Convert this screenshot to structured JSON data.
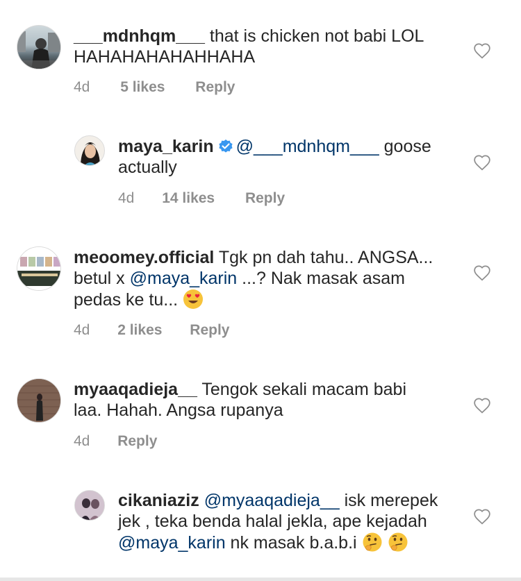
{
  "comments": [
    {
      "username": "___mdnhqm___",
      "text": " that is chicken not babi LOL HAHAHAHAHAHHAHA",
      "time": "4d",
      "likes": "5 likes",
      "reply": "Reply"
    },
    {
      "username": "maya_karin",
      "mention": "@___mdnhqm___",
      "text": " goose actually",
      "time": "4d",
      "likes": "14 likes",
      "reply": "Reply"
    },
    {
      "username": "meoomey.official",
      "text_a": " Tgk pn dah tahu.. ANGSA... betul x ",
      "mention": "@maya_karin",
      "text_b": " ...? Nak masak asam pedas ke tu... ",
      "time": "4d",
      "likes": "2 likes",
      "reply": "Reply"
    },
    {
      "username": "myaaqadieja__",
      "text": " Tengok sekali macam babi laa. Hahah. Angsa rupanya",
      "time": "4d",
      "reply": "Reply"
    },
    {
      "username": "cikaniaziz",
      "mention": "@myaaqadieja__",
      "text_a": " isk merepek jek , teka benda halal jekla, ape kejadah  ",
      "mention2": "@maya_karin",
      "text_b": " nk masak b.a.b.i "
    }
  ],
  "icons": {
    "heart": "heart-outline-icon",
    "verified": "verified-badge-icon",
    "emoji_heart_eyes": "heart-eyes-emoji",
    "emoji_thinking": "thinking-face-emoji"
  },
  "colors": {
    "text": "#262626",
    "meta": "#8e8e8e",
    "mention": "#003569",
    "verified": "#3897f0"
  }
}
